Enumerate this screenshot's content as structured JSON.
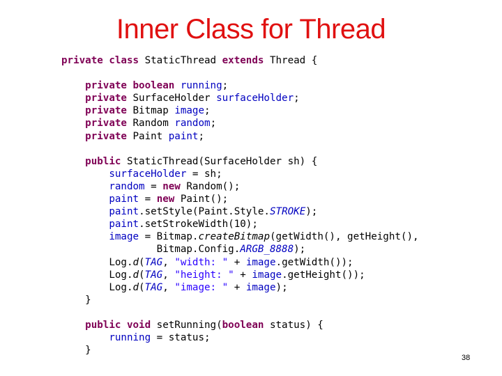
{
  "slide": {
    "title": "Inner Class for Thread",
    "page_number": "38"
  },
  "code": {
    "lines": [
      [
        {
          "t": "private class",
          "c": "kw"
        },
        {
          "t": " StaticThread ",
          "c": ""
        },
        {
          "t": "extends",
          "c": "kw"
        },
        {
          "t": " Thread {",
          "c": ""
        }
      ],
      [],
      [
        {
          "t": "    ",
          "c": ""
        },
        {
          "t": "private boolean",
          "c": "kw"
        },
        {
          "t": " ",
          "c": ""
        },
        {
          "t": "running",
          "c": "fld"
        },
        {
          "t": ";",
          "c": ""
        }
      ],
      [
        {
          "t": "    ",
          "c": ""
        },
        {
          "t": "private",
          "c": "kw"
        },
        {
          "t": " SurfaceHolder ",
          "c": ""
        },
        {
          "t": "surfaceHolder",
          "c": "fld"
        },
        {
          "t": ";",
          "c": ""
        }
      ],
      [
        {
          "t": "    ",
          "c": ""
        },
        {
          "t": "private",
          "c": "kw"
        },
        {
          "t": " Bitmap ",
          "c": ""
        },
        {
          "t": "image",
          "c": "fld"
        },
        {
          "t": ";",
          "c": ""
        }
      ],
      [
        {
          "t": "    ",
          "c": ""
        },
        {
          "t": "private",
          "c": "kw"
        },
        {
          "t": " Random ",
          "c": ""
        },
        {
          "t": "random",
          "c": "fld"
        },
        {
          "t": ";",
          "c": ""
        }
      ],
      [
        {
          "t": "    ",
          "c": ""
        },
        {
          "t": "private",
          "c": "kw"
        },
        {
          "t": " Paint ",
          "c": ""
        },
        {
          "t": "paint",
          "c": "fld"
        },
        {
          "t": ";",
          "c": ""
        }
      ],
      [],
      [
        {
          "t": "    ",
          "c": ""
        },
        {
          "t": "public",
          "c": "kw"
        },
        {
          "t": " StaticThread(SurfaceHolder sh) {",
          "c": ""
        }
      ],
      [
        {
          "t": "        ",
          "c": ""
        },
        {
          "t": "surfaceHolder",
          "c": "fld"
        },
        {
          "t": " = sh;",
          "c": ""
        }
      ],
      [
        {
          "t": "        ",
          "c": ""
        },
        {
          "t": "random",
          "c": "fld"
        },
        {
          "t": " = ",
          "c": ""
        },
        {
          "t": "new",
          "c": "kw"
        },
        {
          "t": " Random();",
          "c": ""
        }
      ],
      [
        {
          "t": "        ",
          "c": ""
        },
        {
          "t": "paint",
          "c": "fld"
        },
        {
          "t": " = ",
          "c": ""
        },
        {
          "t": "new",
          "c": "kw"
        },
        {
          "t": " Paint();",
          "c": ""
        }
      ],
      [
        {
          "t": "        ",
          "c": ""
        },
        {
          "t": "paint",
          "c": "fld"
        },
        {
          "t": ".setStyle(Paint.Style.",
          "c": ""
        },
        {
          "t": "STROKE",
          "c": "st"
        },
        {
          "t": ");",
          "c": ""
        }
      ],
      [
        {
          "t": "        ",
          "c": ""
        },
        {
          "t": "paint",
          "c": "fld"
        },
        {
          "t": ".setStrokeWidth(10);",
          "c": ""
        }
      ],
      [
        {
          "t": "        ",
          "c": ""
        },
        {
          "t": "image",
          "c": "fld"
        },
        {
          "t": " = Bitmap.",
          "c": ""
        },
        {
          "t": "createBitmap",
          "c": "mi"
        },
        {
          "t": "(getWidth(), getHeight(),",
          "c": ""
        }
      ],
      [
        {
          "t": "                Bitmap.Config.",
          "c": ""
        },
        {
          "t": "ARGB_8888",
          "c": "st"
        },
        {
          "t": ");",
          "c": ""
        }
      ],
      [
        {
          "t": "        Log.",
          "c": ""
        },
        {
          "t": "d",
          "c": "mi"
        },
        {
          "t": "(",
          "c": ""
        },
        {
          "t": "TAG",
          "c": "st"
        },
        {
          "t": ", ",
          "c": ""
        },
        {
          "t": "\"width: \"",
          "c": "str"
        },
        {
          "t": " + ",
          "c": ""
        },
        {
          "t": "image",
          "c": "fld"
        },
        {
          "t": ".getWidth());",
          "c": ""
        }
      ],
      [
        {
          "t": "        Log.",
          "c": ""
        },
        {
          "t": "d",
          "c": "mi"
        },
        {
          "t": "(",
          "c": ""
        },
        {
          "t": "TAG",
          "c": "st"
        },
        {
          "t": ", ",
          "c": ""
        },
        {
          "t": "\"height: \"",
          "c": "str"
        },
        {
          "t": " + ",
          "c": ""
        },
        {
          "t": "image",
          "c": "fld"
        },
        {
          "t": ".getHeight());",
          "c": ""
        }
      ],
      [
        {
          "t": "        Log.",
          "c": ""
        },
        {
          "t": "d",
          "c": "mi"
        },
        {
          "t": "(",
          "c": ""
        },
        {
          "t": "TAG",
          "c": "st"
        },
        {
          "t": ", ",
          "c": ""
        },
        {
          "t": "\"image: \"",
          "c": "str"
        },
        {
          "t": " + ",
          "c": ""
        },
        {
          "t": "image",
          "c": "fld"
        },
        {
          "t": ");",
          "c": ""
        }
      ],
      [
        {
          "t": "    }",
          "c": ""
        }
      ],
      [],
      [
        {
          "t": "    ",
          "c": ""
        },
        {
          "t": "public void",
          "c": "kw"
        },
        {
          "t": " setRunning(",
          "c": ""
        },
        {
          "t": "boolean",
          "c": "kw"
        },
        {
          "t": " status) {",
          "c": ""
        }
      ],
      [
        {
          "t": "        ",
          "c": ""
        },
        {
          "t": "running",
          "c": "fld"
        },
        {
          "t": " = status;",
          "c": ""
        }
      ],
      [
        {
          "t": "    }",
          "c": ""
        }
      ]
    ]
  }
}
